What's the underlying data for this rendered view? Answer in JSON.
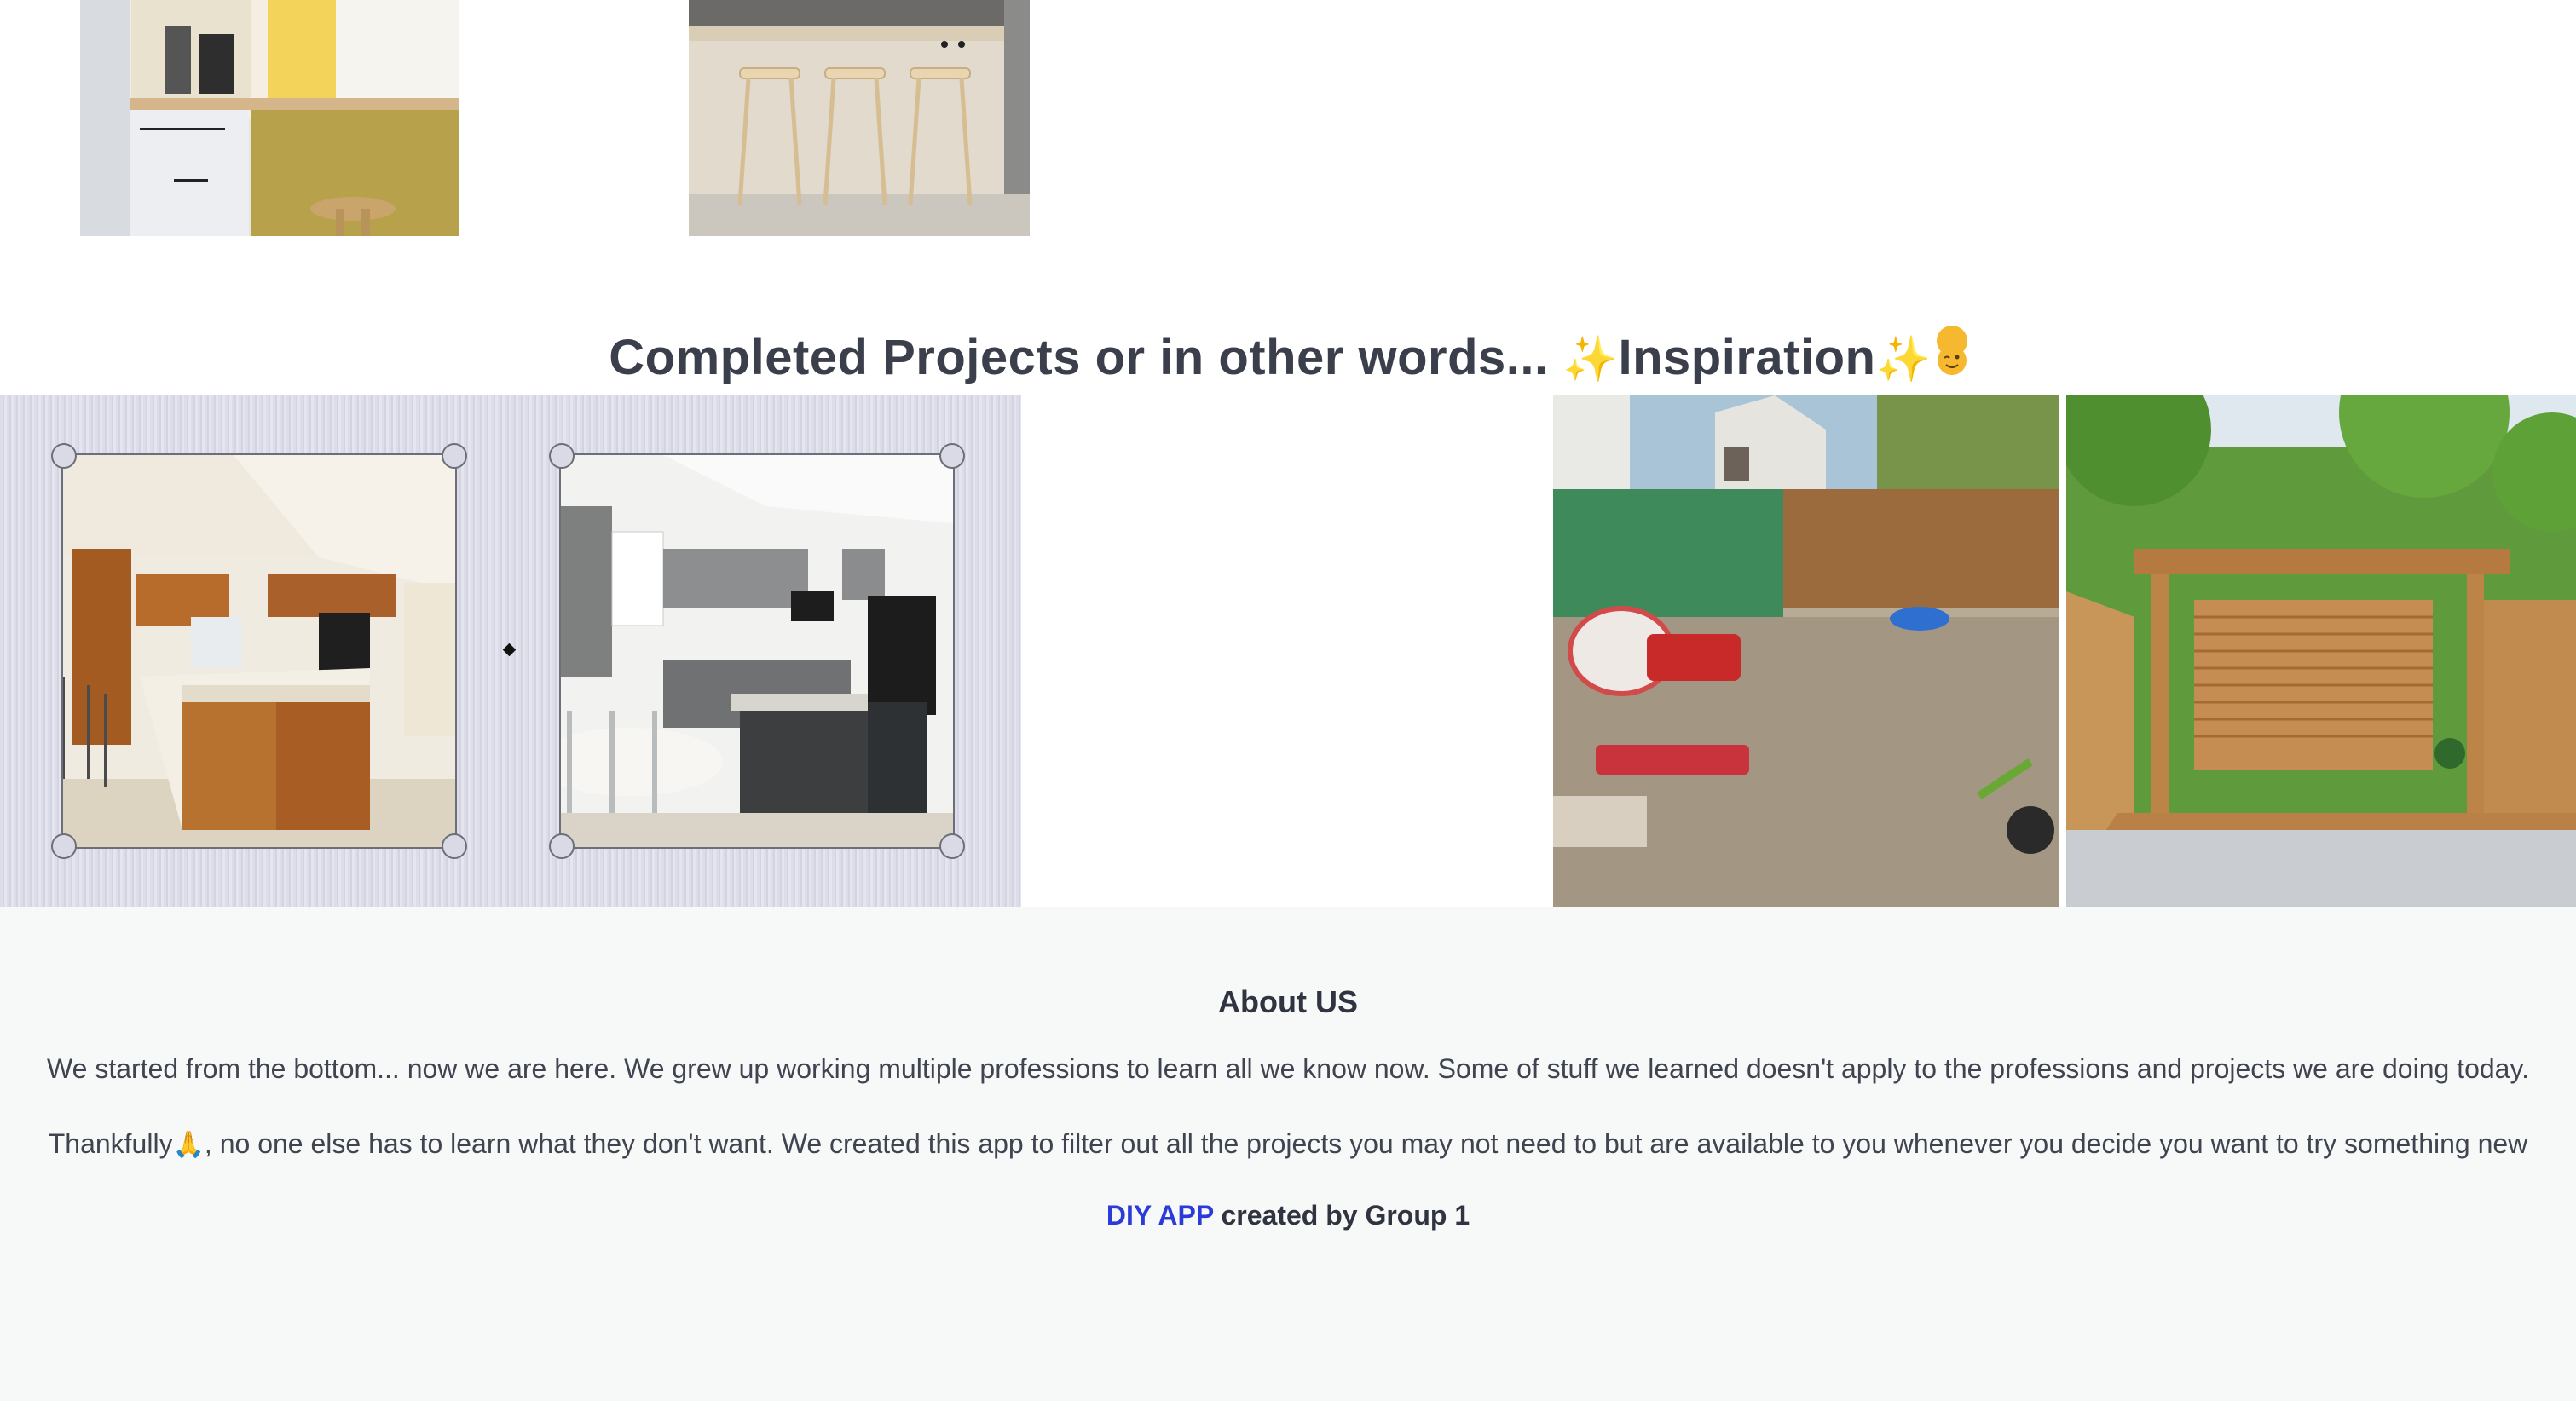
{
  "section": {
    "heading_text": "Completed Projects or in other words...",
    "heading_spark_left": "✨",
    "heading_highlight": "Inspiration",
    "heading_spark_right": "✨"
  },
  "gallery_top": [
    {
      "name": "kitchen-coffee-nook"
    },
    {
      "name": "kitchen-island-stools"
    }
  ],
  "projects": [
    {
      "name": "kitchen-before"
    },
    {
      "name": "kitchen-after"
    },
    {
      "name": "backyard-before"
    },
    {
      "name": "backyard-after"
    }
  ],
  "about": {
    "title": "About US",
    "p1": "We started from the bottom... now we are here. We grew up working multiple professions to learn all we know now. Some of stuff we learned doesn't apply to the professions and projects we are doing today.",
    "p2_start": "Thankfully",
    "p2_emoji": "🙏",
    "p2_end": ", no one else has to learn what they don't want. We created this app to filter out all the projects you may not need to but are available to you whenever you decide you want to try something new"
  },
  "footer": {
    "brand": "DIY APP",
    "credit": " created by Group 1"
  },
  "colors": {
    "heading": "#3a3f4b",
    "brand_link": "#2b3bd8",
    "about_bg": "#f7f8f8"
  }
}
